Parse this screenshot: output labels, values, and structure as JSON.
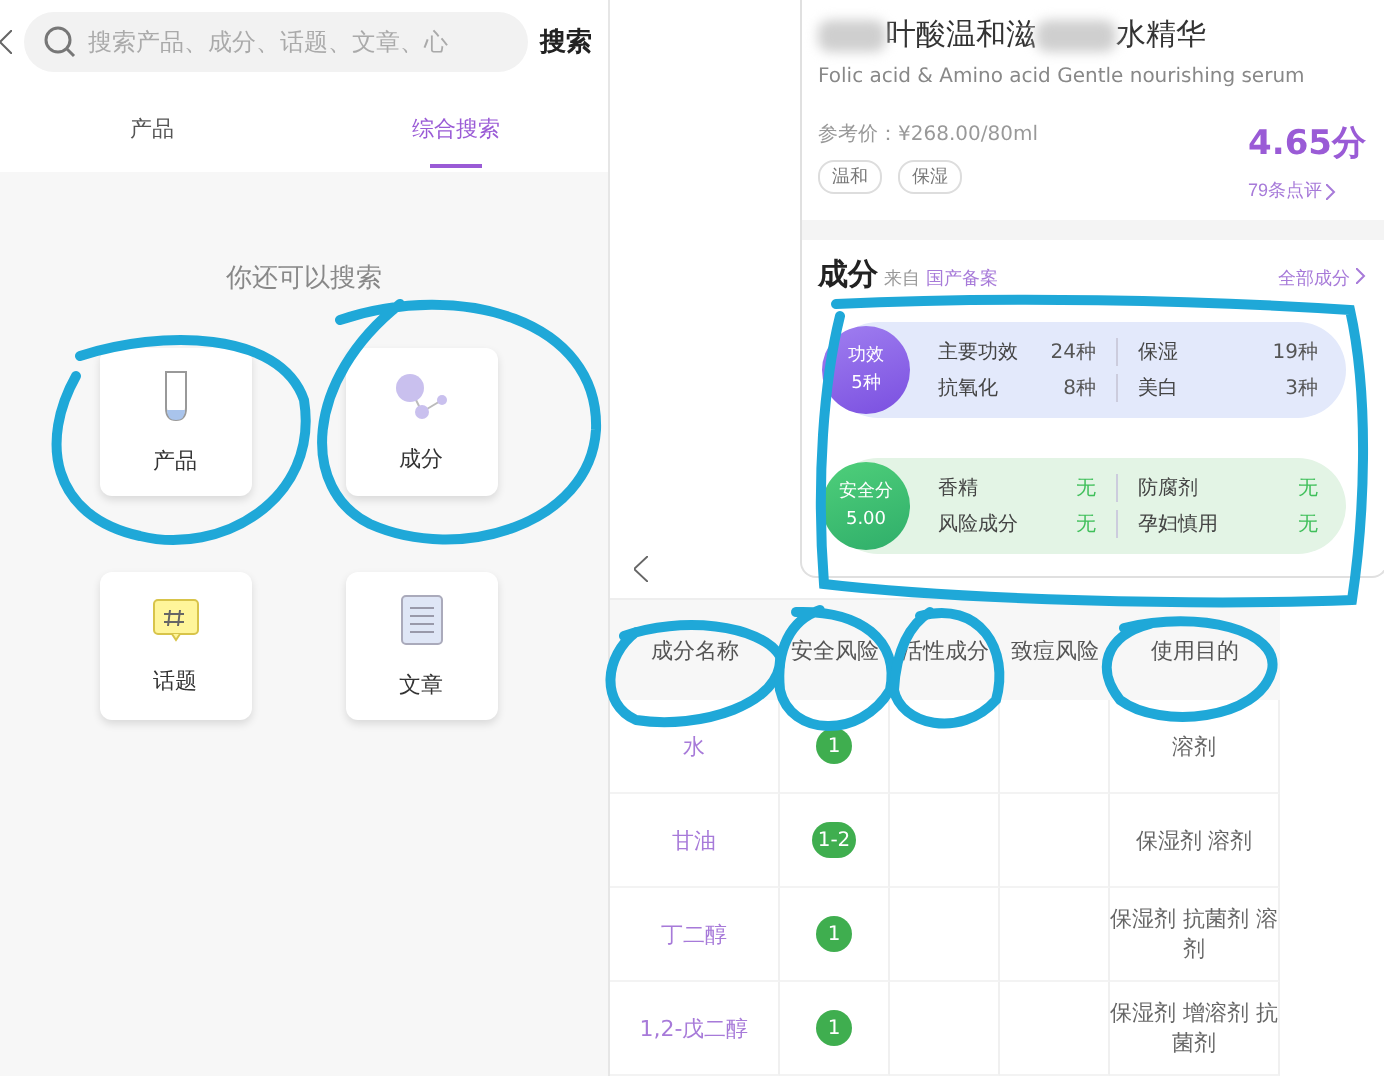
{
  "search_screen": {
    "search": {
      "placeholder": "搜索产品、成分、话题、文章、心"
    },
    "search_button": "搜索",
    "tabs": [
      {
        "label": "产品",
        "selected": false
      },
      {
        "label": "综合搜索",
        "selected": true
      }
    ],
    "prompt": "你还可以搜索",
    "categories": [
      {
        "label": "产品",
        "kind": "product"
      },
      {
        "label": "成分",
        "kind": "ingredient"
      },
      {
        "label": "话题",
        "kind": "topic"
      },
      {
        "label": "文章",
        "kind": "article"
      }
    ]
  },
  "product_screen": {
    "title_parts": [
      "叶酸温和滋",
      "水精华"
    ],
    "subtitle": "Folic acid  &  Amino acid Gentle nourishing  serum",
    "price": "参考价：¥268.00/80ml",
    "tags": [
      "温和",
      "保湿"
    ],
    "score": "4.65分",
    "reviews": "79条点评",
    "section": {
      "title": "成分",
      "source_prefix": "来自",
      "source": "国产备案",
      "link": "全部成分"
    },
    "summary": [
      {
        "kind": "efficacy",
        "badge_title": "功效",
        "badge_value": "5种",
        "items": [
          {
            "name": "主要功效",
            "value": "24种"
          },
          {
            "name": "保湿",
            "value": "19种"
          },
          {
            "name": "抗氧化",
            "value": "8种"
          },
          {
            "name": "美白",
            "value": "3种"
          }
        ]
      },
      {
        "kind": "safety",
        "badge_title": "安全分",
        "badge_value": "5.00",
        "items": [
          {
            "name": "香精",
            "value": "无"
          },
          {
            "name": "防腐剂",
            "value": "无"
          },
          {
            "name": "风险成分",
            "value": "无"
          },
          {
            "name": "孕妇慎用",
            "value": "无"
          }
        ]
      }
    ]
  },
  "ingredient_screen": {
    "columns": [
      "成分名称",
      "安全风险",
      "活性成分",
      "致痘风险",
      "使用目的"
    ],
    "rows": [
      {
        "name": "水",
        "safety": "1",
        "purpose": "溶剂"
      },
      {
        "name": "甘油",
        "safety": "1-2",
        "purpose": "保湿剂 溶剂"
      },
      {
        "name": "丁二醇",
        "safety": "1",
        "purpose": "保湿剂 抗菌剂 溶剂"
      },
      {
        "name": "1,2-戊二醇",
        "safety": "1",
        "purpose": "保湿剂 增溶剂 抗菌剂"
      }
    ]
  }
}
